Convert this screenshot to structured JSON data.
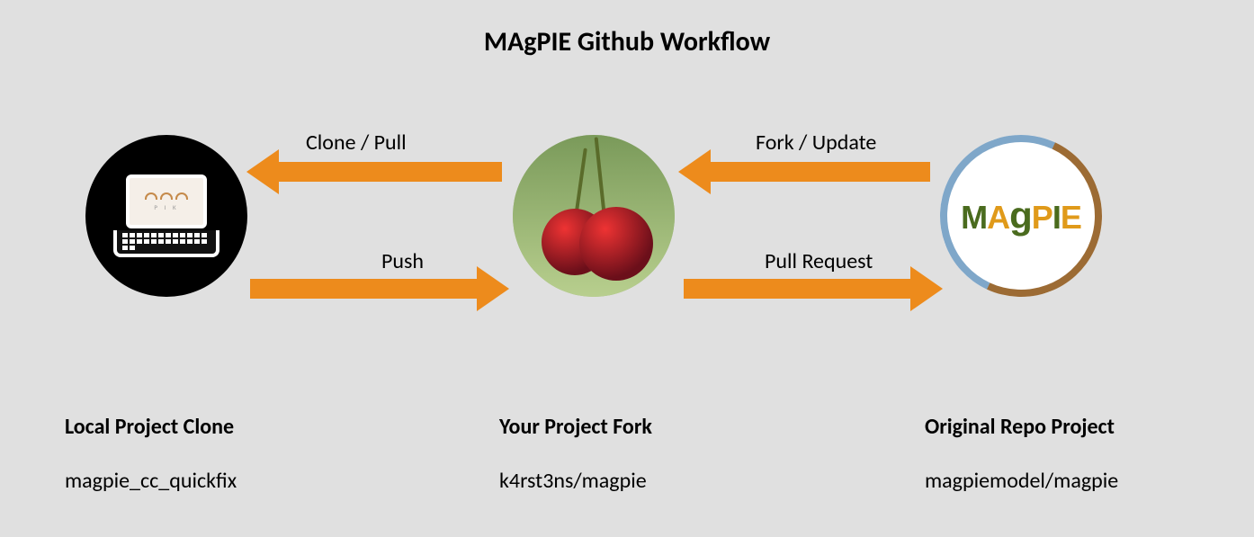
{
  "title": "MAgPIE Github Workflow",
  "arrows": {
    "clone_pull": "Clone / Pull",
    "push": "Push",
    "fork_update": "Fork / Update",
    "pull_request": "Pull Request"
  },
  "nodes": {
    "local": {
      "heading": "Local Project Clone",
      "sub": "magpie_cc_quickfix",
      "icon_inner_text": "P I K"
    },
    "fork": {
      "heading": "Your Project Fork",
      "sub": "k4rst3ns/magpie"
    },
    "origin": {
      "heading": "Original Repo Project",
      "sub": "magpiemodel/magpie",
      "logo_text": "MAgPIE"
    }
  }
}
